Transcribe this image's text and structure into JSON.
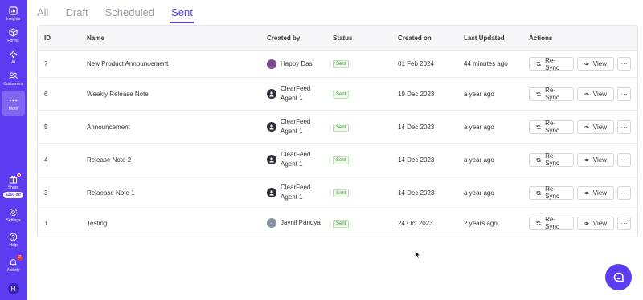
{
  "sidebar": {
    "items": [
      {
        "label": "Insights",
        "icon": "bar-chart-icon"
      },
      {
        "label": "Forms",
        "icon": "cube-icon"
      },
      {
        "label": "AI",
        "icon": "sparkle-icon"
      },
      {
        "label": "Customers",
        "icon": "users-icon"
      },
      {
        "label": "More",
        "icon": "dots-icon"
      }
    ],
    "bottom": [
      {
        "label": "Share",
        "icon": "gift-icon"
      },
      {
        "label": "Settings",
        "icon": "gear-icon"
      },
      {
        "label": "Help",
        "icon": "help-icon"
      },
      {
        "label": "Activity",
        "icon": "bell-icon"
      }
    ],
    "share_offer": "$250 off",
    "activity_count": "2",
    "avatar_initial": "H"
  },
  "tabs": [
    "All",
    "Draft",
    "Scheduled",
    "Sent"
  ],
  "active_tab": "Sent",
  "table": {
    "headers": [
      "ID",
      "Name",
      "Created by",
      "Status",
      "Created on",
      "Last Updated",
      "Actions"
    ],
    "rows": [
      {
        "id": "7",
        "name": "New Product Announcement",
        "by_line1": "Happy Das",
        "by_line2": "",
        "avatar": "photo",
        "status": "Sent",
        "created": "01 Feb 2024",
        "updated": "44 minutes ago"
      },
      {
        "id": "6",
        "name": "Weekly Release Note",
        "by_line1": "ClearFeed",
        "by_line2": "Agent 1",
        "avatar": "bot",
        "status": "Sent",
        "created": "19 Dec 2023",
        "updated": "a year ago"
      },
      {
        "id": "5",
        "name": "Announcement",
        "by_line1": "ClearFeed",
        "by_line2": "Agent 1",
        "avatar": "bot",
        "status": "Sent",
        "created": "14 Dec 2023",
        "updated": "a year ago"
      },
      {
        "id": "4",
        "name": "Release Note 2",
        "by_line1": "ClearFeed",
        "by_line2": "Agent 1",
        "avatar": "bot",
        "status": "Sent",
        "created": "14 Dec 2023",
        "updated": "a year ago"
      },
      {
        "id": "3",
        "name": "Relaease Note 1",
        "by_line1": "ClearFeed",
        "by_line2": "Agent 1",
        "avatar": "bot",
        "status": "Sent",
        "created": "14 Dec 2023",
        "updated": "a year ago"
      },
      {
        "id": "1",
        "name": "Testing",
        "by_line1": "Jaynil Pandya",
        "by_line2": "",
        "avatar": "J",
        "status": "Sent",
        "created": "24 Oct 2023",
        "updated": "2 years ago"
      }
    ],
    "actions": {
      "resync": "Re-Sync",
      "view": "View",
      "more": "···"
    }
  },
  "colors": {
    "brand": "#5b3cf0",
    "status_green": "#3c9a3c"
  }
}
